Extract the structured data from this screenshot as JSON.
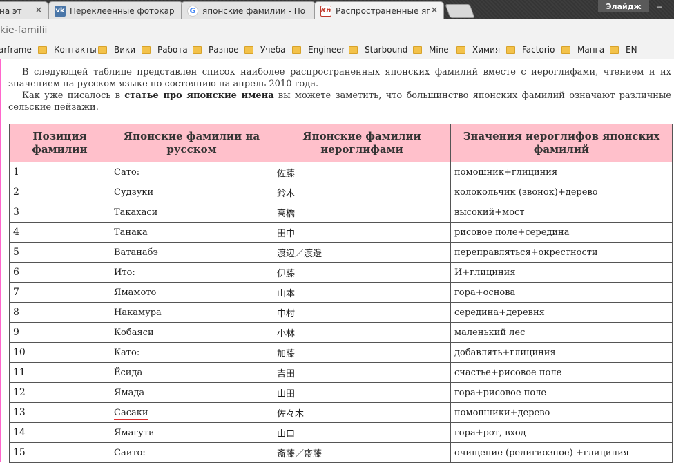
{
  "tabs": [
    {
      "title": "на эт",
      "favicon": "partial-tab",
      "active": false
    },
    {
      "title": "Переклеенные фотокар",
      "favicon": "vk-icon",
      "active": false
    },
    {
      "title": "японские фамилии - По",
      "favicon": "google-icon",
      "active": false
    },
    {
      "title": "Распространенные япон",
      "favicon": "kn-icon",
      "active": true
    }
  ],
  "user_label": "Элайдж",
  "address": {
    "url_fragment": "kie-familii"
  },
  "bookmarks": [
    "arframe",
    "Контакты",
    "Вики",
    "Работа",
    "Разное",
    "Учеба",
    "Engineer",
    "Starbound",
    "Mine",
    "Химия",
    "Factorio",
    "Манга",
    "EN"
  ],
  "article": {
    "paragraph1": "В следующей таблице представлен список наиболее распространенных японских фамилий вместе с иероглифами, чтением и их значением на русском языке по состоянию на апрель 2010 года.",
    "paragraph2_before": "Как уже писалось в ",
    "paragraph2_bold": "статье про японские имена",
    "paragraph2_after": " вы можете заметить, что большинство японских фамилий означают различные сельские пейзажи."
  },
  "table": {
    "headers": [
      "Позиция фамилии",
      "Японские фамилии на русском",
      "Японские фамилии иероглифами",
      "Значения иероглифов японских фамилий"
    ],
    "rows": [
      {
        "pos": "1",
        "ru": "Сато:",
        "kanji": "佐藤",
        "meaning": "помошник+глициния"
      },
      {
        "pos": "2",
        "ru": "Судзуки",
        "kanji": "鈴木",
        "meaning": "колокольчик (звонок)+дерево"
      },
      {
        "pos": "3",
        "ru": "Такахаси",
        "kanji": "高橋",
        "meaning": "высокий+мост"
      },
      {
        "pos": "4",
        "ru": "Танака",
        "kanji": "田中",
        "meaning": "рисовое поле+середина"
      },
      {
        "pos": "5",
        "ru": "Ватанабэ",
        "kanji": "渡辺／渡邊",
        "meaning": "переправляться+окрестности"
      },
      {
        "pos": "6",
        "ru": "Ито:",
        "kanji": "伊藤",
        "meaning": "И+глициния"
      },
      {
        "pos": "7",
        "ru": "Ямамото",
        "kanji": "山本",
        "meaning": "гора+основа"
      },
      {
        "pos": "8",
        "ru": "Накамура",
        "kanji": "中村",
        "meaning": "середина+деревня"
      },
      {
        "pos": "9",
        "ru": "Кобаяси",
        "kanji": "小林",
        "meaning": "маленький лес"
      },
      {
        "pos": "10",
        "ru": "Като:",
        "kanji": "加藤",
        "meaning": "добавлять+глициния"
      },
      {
        "pos": "11",
        "ru": "Ёсида",
        "kanji": "吉田",
        "meaning": "счастье+рисовое поле"
      },
      {
        "pos": "12",
        "ru": "Ямада",
        "kanji": "山田",
        "meaning": "гора+рисовое поле"
      },
      {
        "pos": "13",
        "ru": "Сасаки",
        "kanji": "佐々木",
        "meaning": "помошники+дерево"
      },
      {
        "pos": "14",
        "ru": "Ямагути",
        "kanji": "山口",
        "meaning": "гора+рот, вход"
      },
      {
        "pos": "15",
        "ru": "Саито:",
        "kanji": "斎藤／齋藤",
        "meaning": "очищение (религиозное) +глициния"
      }
    ]
  },
  "colors": {
    "header_bg": "#ffc0cb",
    "highlight_underline": "#e03030"
  }
}
